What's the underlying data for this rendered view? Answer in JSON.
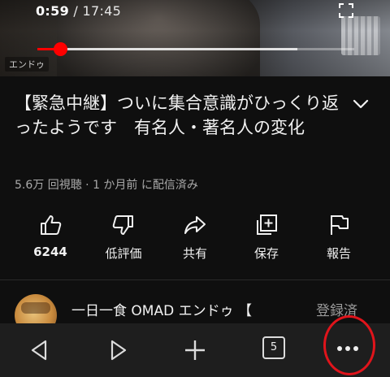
{
  "player": {
    "current_time": "0:59",
    "separator": "/",
    "duration": "17:45",
    "progress_fraction": 0.071,
    "buffered_fraction": 0.82,
    "watermark_text": "エンドゥ",
    "fullscreen_icon": "fullscreen-icon"
  },
  "video": {
    "title": "【緊急中継】ついに集合意識がひっくり返ったようです　有名人・著名人の変化",
    "meta": "5.6万 回視聴 · 1 か月前 に配信済み",
    "expand_icon": "chevron-down-icon"
  },
  "actions": [
    {
      "icon": "thumbs-up-icon",
      "label": "6244"
    },
    {
      "icon": "thumbs-down-icon",
      "label": "低評価"
    },
    {
      "icon": "share-icon",
      "label": "共有"
    },
    {
      "icon": "save-to-playlist-icon",
      "label": "保存"
    },
    {
      "icon": "flag-icon",
      "label": "報告"
    }
  ],
  "channel": {
    "name": "一日一食 OMAD エンドゥ 【",
    "subscribe_label": "登録済"
  },
  "bottom_nav": {
    "back_icon": "back-triangle-icon",
    "forward_icon": "forward-triangle-icon",
    "new_tab_icon": "plus-icon",
    "tab_count": "5",
    "menu_icon": "more-horizontal-icon"
  },
  "colors": {
    "accent_red": "#ff0000",
    "background": "#0f0f0f",
    "nav_background": "#1e1e1e",
    "highlight_circle": "#e0141b"
  }
}
